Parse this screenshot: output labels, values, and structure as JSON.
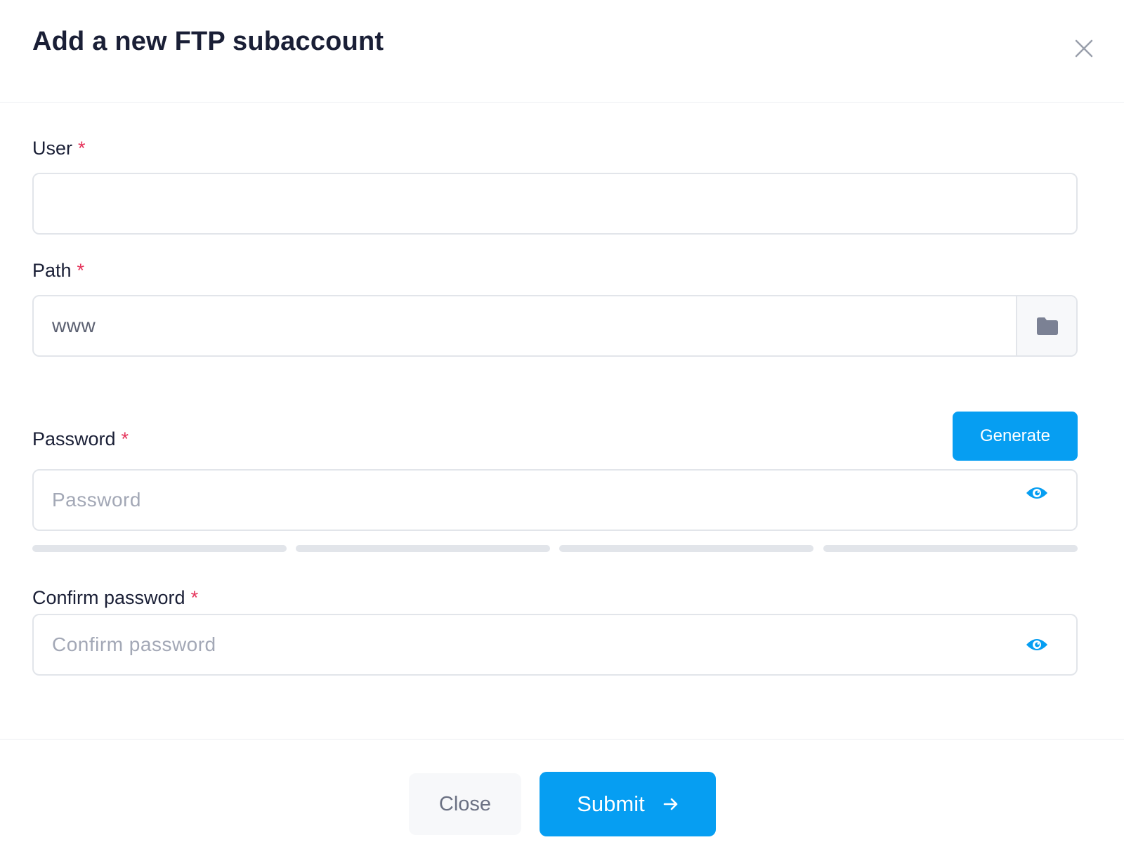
{
  "header": {
    "title": "Add a new FTP subaccount"
  },
  "form": {
    "user": {
      "label": "User",
      "required_mark": "*",
      "value": ""
    },
    "path": {
      "label": "Path",
      "required_mark": "*",
      "value": "www"
    },
    "password": {
      "label": "Password",
      "required_mark": "*",
      "value": "",
      "placeholder": "Password",
      "generate_label": "Generate"
    },
    "confirm_password": {
      "label": "Confirm password",
      "required_mark": "*",
      "value": "",
      "placeholder": "Confirm password"
    },
    "strength_level": 0
  },
  "footer": {
    "close_label": "Close",
    "submit_label": "Submit"
  },
  "icons": {
    "close": "close-icon",
    "folder": "folder-icon",
    "eye": "eye-icon",
    "arrow": "arrow-right-icon"
  },
  "colors": {
    "accent": "#069ef2",
    "required": "#e5345b",
    "border": "#e2e5ea"
  }
}
